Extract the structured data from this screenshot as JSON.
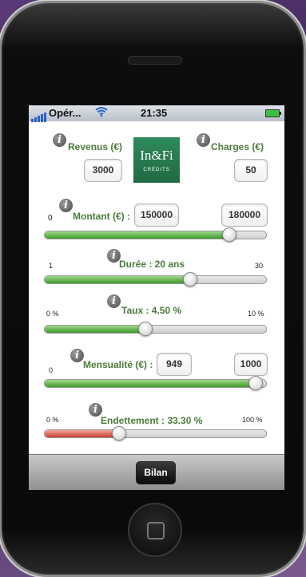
{
  "status_bar": {
    "carrier": "Opér...",
    "time": "21:35",
    "wifi_icon": "wifi-icon",
    "signal_icon": "signal-bars-icon",
    "battery_icon": "battery-icon"
  },
  "header": {
    "revenus_label": "Revenus (€)",
    "revenus_value": "3000",
    "charges_label": "Charges (€)",
    "charges_value": "50",
    "logo_line1": "In&Fi",
    "logo_line2": "CRÉDITS"
  },
  "montant": {
    "label": "Montant (€) :",
    "min": "0",
    "value": "150000",
    "max": "180000",
    "level": 0.83
  },
  "duree": {
    "label": "Durée : 20 ans",
    "min": "1",
    "max": "30",
    "level": 0.655
  },
  "taux": {
    "label": "Taux : 4.50 %",
    "min": "0 %",
    "max": "10 %",
    "level": 0.45
  },
  "mensualite": {
    "label": "Mensualité (€) :",
    "min": "0",
    "value": "949",
    "max": "1000",
    "level": 0.949
  },
  "endettement": {
    "label": "Endettement : 33.30 %",
    "min": "0 %",
    "max": "100 %",
    "level": 0.333
  },
  "toolbar": {
    "bilan_label": "Bilan"
  },
  "colors": {
    "label_green": "#4c7a3a",
    "slider_green": "#3d9a2c",
    "slider_red": "#c8402e",
    "logo_green": "#1f6a42"
  }
}
